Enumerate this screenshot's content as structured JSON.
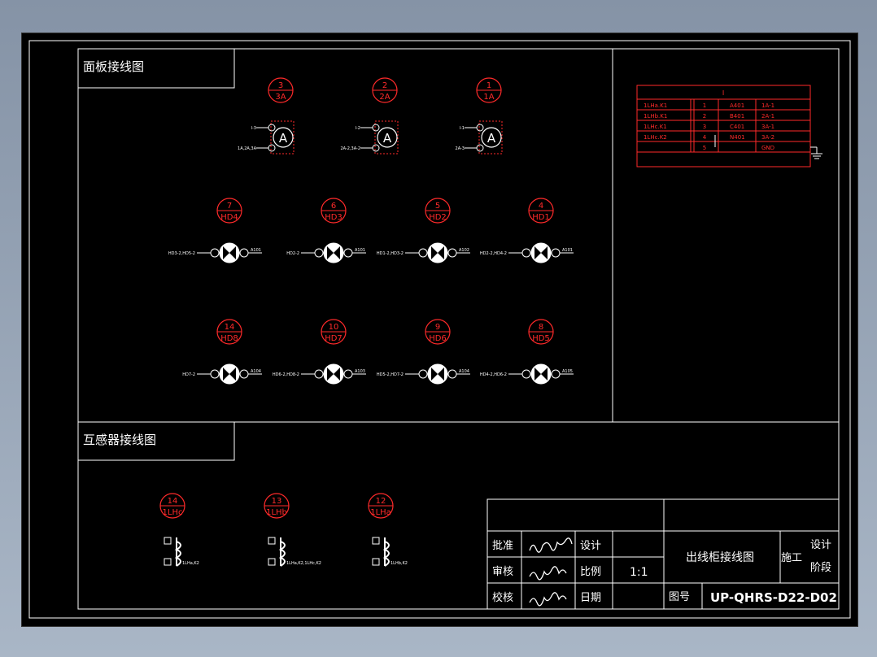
{
  "colors": {
    "background": "#000000",
    "frame": "#ffffff",
    "tag": "#ff2a2a",
    "workspace": "#8c9aae"
  },
  "sections": {
    "panel_title": "面板接线图",
    "ct_title": "互感器接线图"
  },
  "ammeters": [
    {
      "num": "3",
      "code": "3A",
      "wire1": "I-3",
      "wire2": "1A,2A,3A"
    },
    {
      "num": "2",
      "code": "2A",
      "wire1": "I-2",
      "wire2": "2A-2,3A-2"
    },
    {
      "num": "1",
      "code": "1A",
      "wire1": "I-1",
      "wire2": "2A-3"
    }
  ],
  "lamps": [
    {
      "num": "7",
      "code": "HD4",
      "left": "HD3-2,HD5-2",
      "right": "A101"
    },
    {
      "num": "6",
      "code": "HD3",
      "left": "HD2-2",
      "right": "A101"
    },
    {
      "num": "5",
      "code": "HD2",
      "left": "HD1-2,HD3-2",
      "right": "A102"
    },
    {
      "num": "4",
      "code": "HD1",
      "left": "HD2-2,HD4-2",
      "right": "A101"
    },
    {
      "num": "14",
      "code": "HD8",
      "left": "HD7-2",
      "right": "A104"
    },
    {
      "num": "10",
      "code": "HD7",
      "left": "HD6-2,HD8-2",
      "right": "A103"
    },
    {
      "num": "9",
      "code": "HD6",
      "left": "HD5-2,HD7-2",
      "right": "A104"
    },
    {
      "num": "8",
      "code": "HD5",
      "left": "HD4-2,HD6-2",
      "right": "A105"
    }
  ],
  "transformers": [
    {
      "num": "14",
      "code": "1LHc",
      "label": "1LHa,K2"
    },
    {
      "num": "13",
      "code": "1LHb",
      "label": "1LHa,K2,1LHc,K2"
    },
    {
      "num": "12",
      "code": "1LHa",
      "label": "1LHb,K2"
    }
  ],
  "terminal_block": {
    "header": "I",
    "rows": [
      {
        "device": "1LHa.K1",
        "no": "1",
        "wire": "A401",
        "target": "1A-1"
      },
      {
        "device": "1LHb.K1",
        "no": "2",
        "wire": "B401",
        "target": "2A-1"
      },
      {
        "device": "1LHc.K1",
        "no": "3",
        "wire": "C401",
        "target": "3A-1"
      },
      {
        "device": "1LHc.K2",
        "no": "4",
        "wire": "N401",
        "target": "3A-2"
      },
      {
        "device": "",
        "no": "5",
        "wire": "",
        "target": "GND"
      }
    ]
  },
  "title_block": {
    "approve": "批准",
    "review": "审核",
    "check": "校核",
    "design": "设计",
    "scale_label": "比例",
    "scale": "1:1",
    "date_label": "日期",
    "drawing_name": "出线柜接线图",
    "stage_value": "施工",
    "stage_label_1": "设计",
    "stage_label_2": "阶段",
    "drawing_no_label": "图号",
    "drawing_no": "UP-QHRS-D22-D02"
  }
}
